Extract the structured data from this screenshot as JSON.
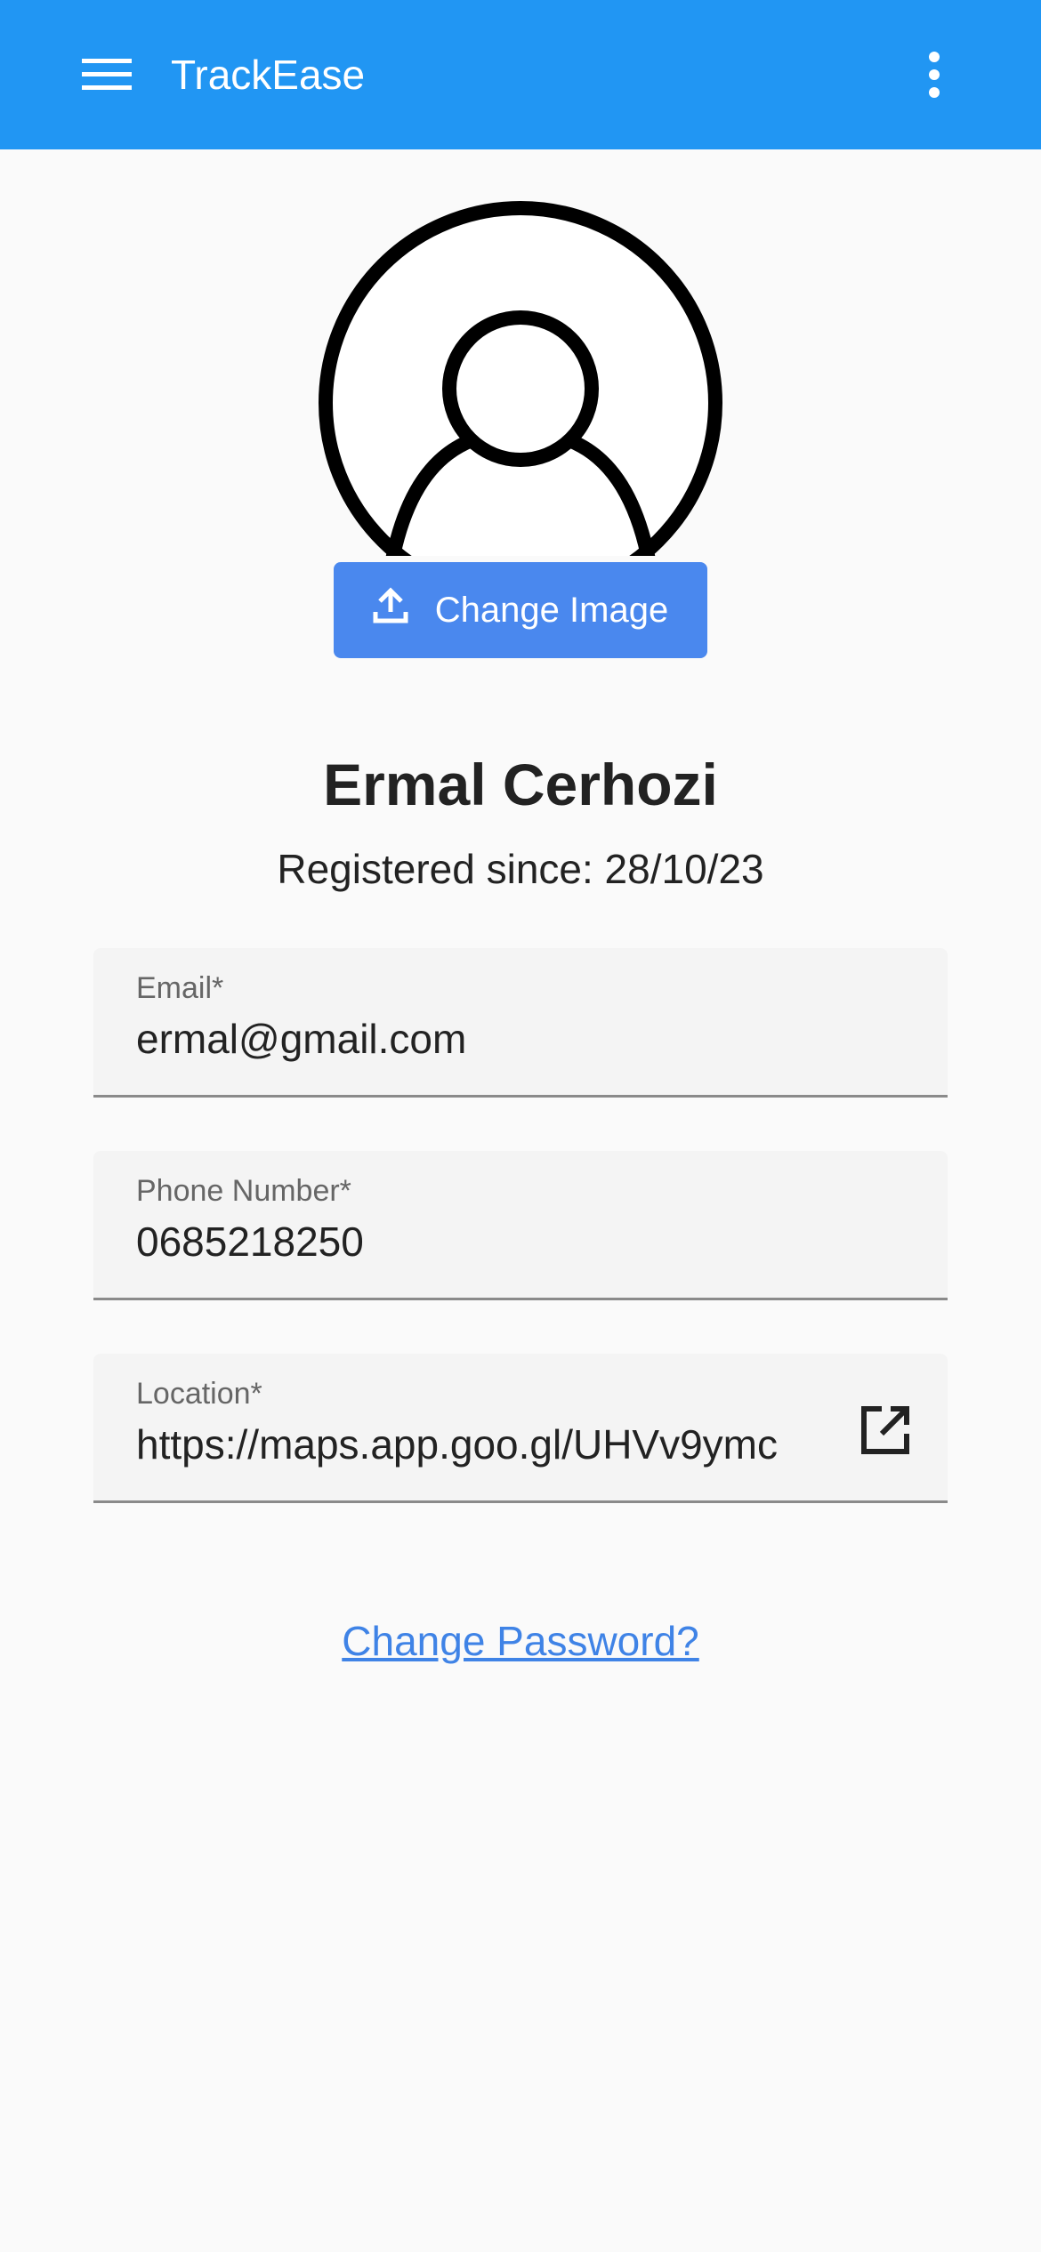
{
  "appbar": {
    "title": "TrackEase",
    "menu_icon": "hamburger-menu-icon",
    "more_icon": "more-vert-icon",
    "color": "#2196f3"
  },
  "profile": {
    "avatar_icon": "person-avatar-icon",
    "change_image_label": "Change Image",
    "upload_icon": "upload-icon",
    "name": "Ermal Cerhozi",
    "registered": "Registered since: 28/10/23"
  },
  "fields": {
    "email": {
      "label": "Email*",
      "value": "ermal@gmail.com"
    },
    "phone": {
      "label": "Phone Number*",
      "value": "0685218250"
    },
    "location": {
      "label": "Location*",
      "value": "https://maps.app.goo.gl/UHVv9ymc",
      "action_icon": "open-in-new-icon"
    }
  },
  "change_password_label": "Change Password?",
  "colors": {
    "accent_button": "#4a88ee",
    "link": "#3f83e6",
    "background": "#fafafa"
  }
}
